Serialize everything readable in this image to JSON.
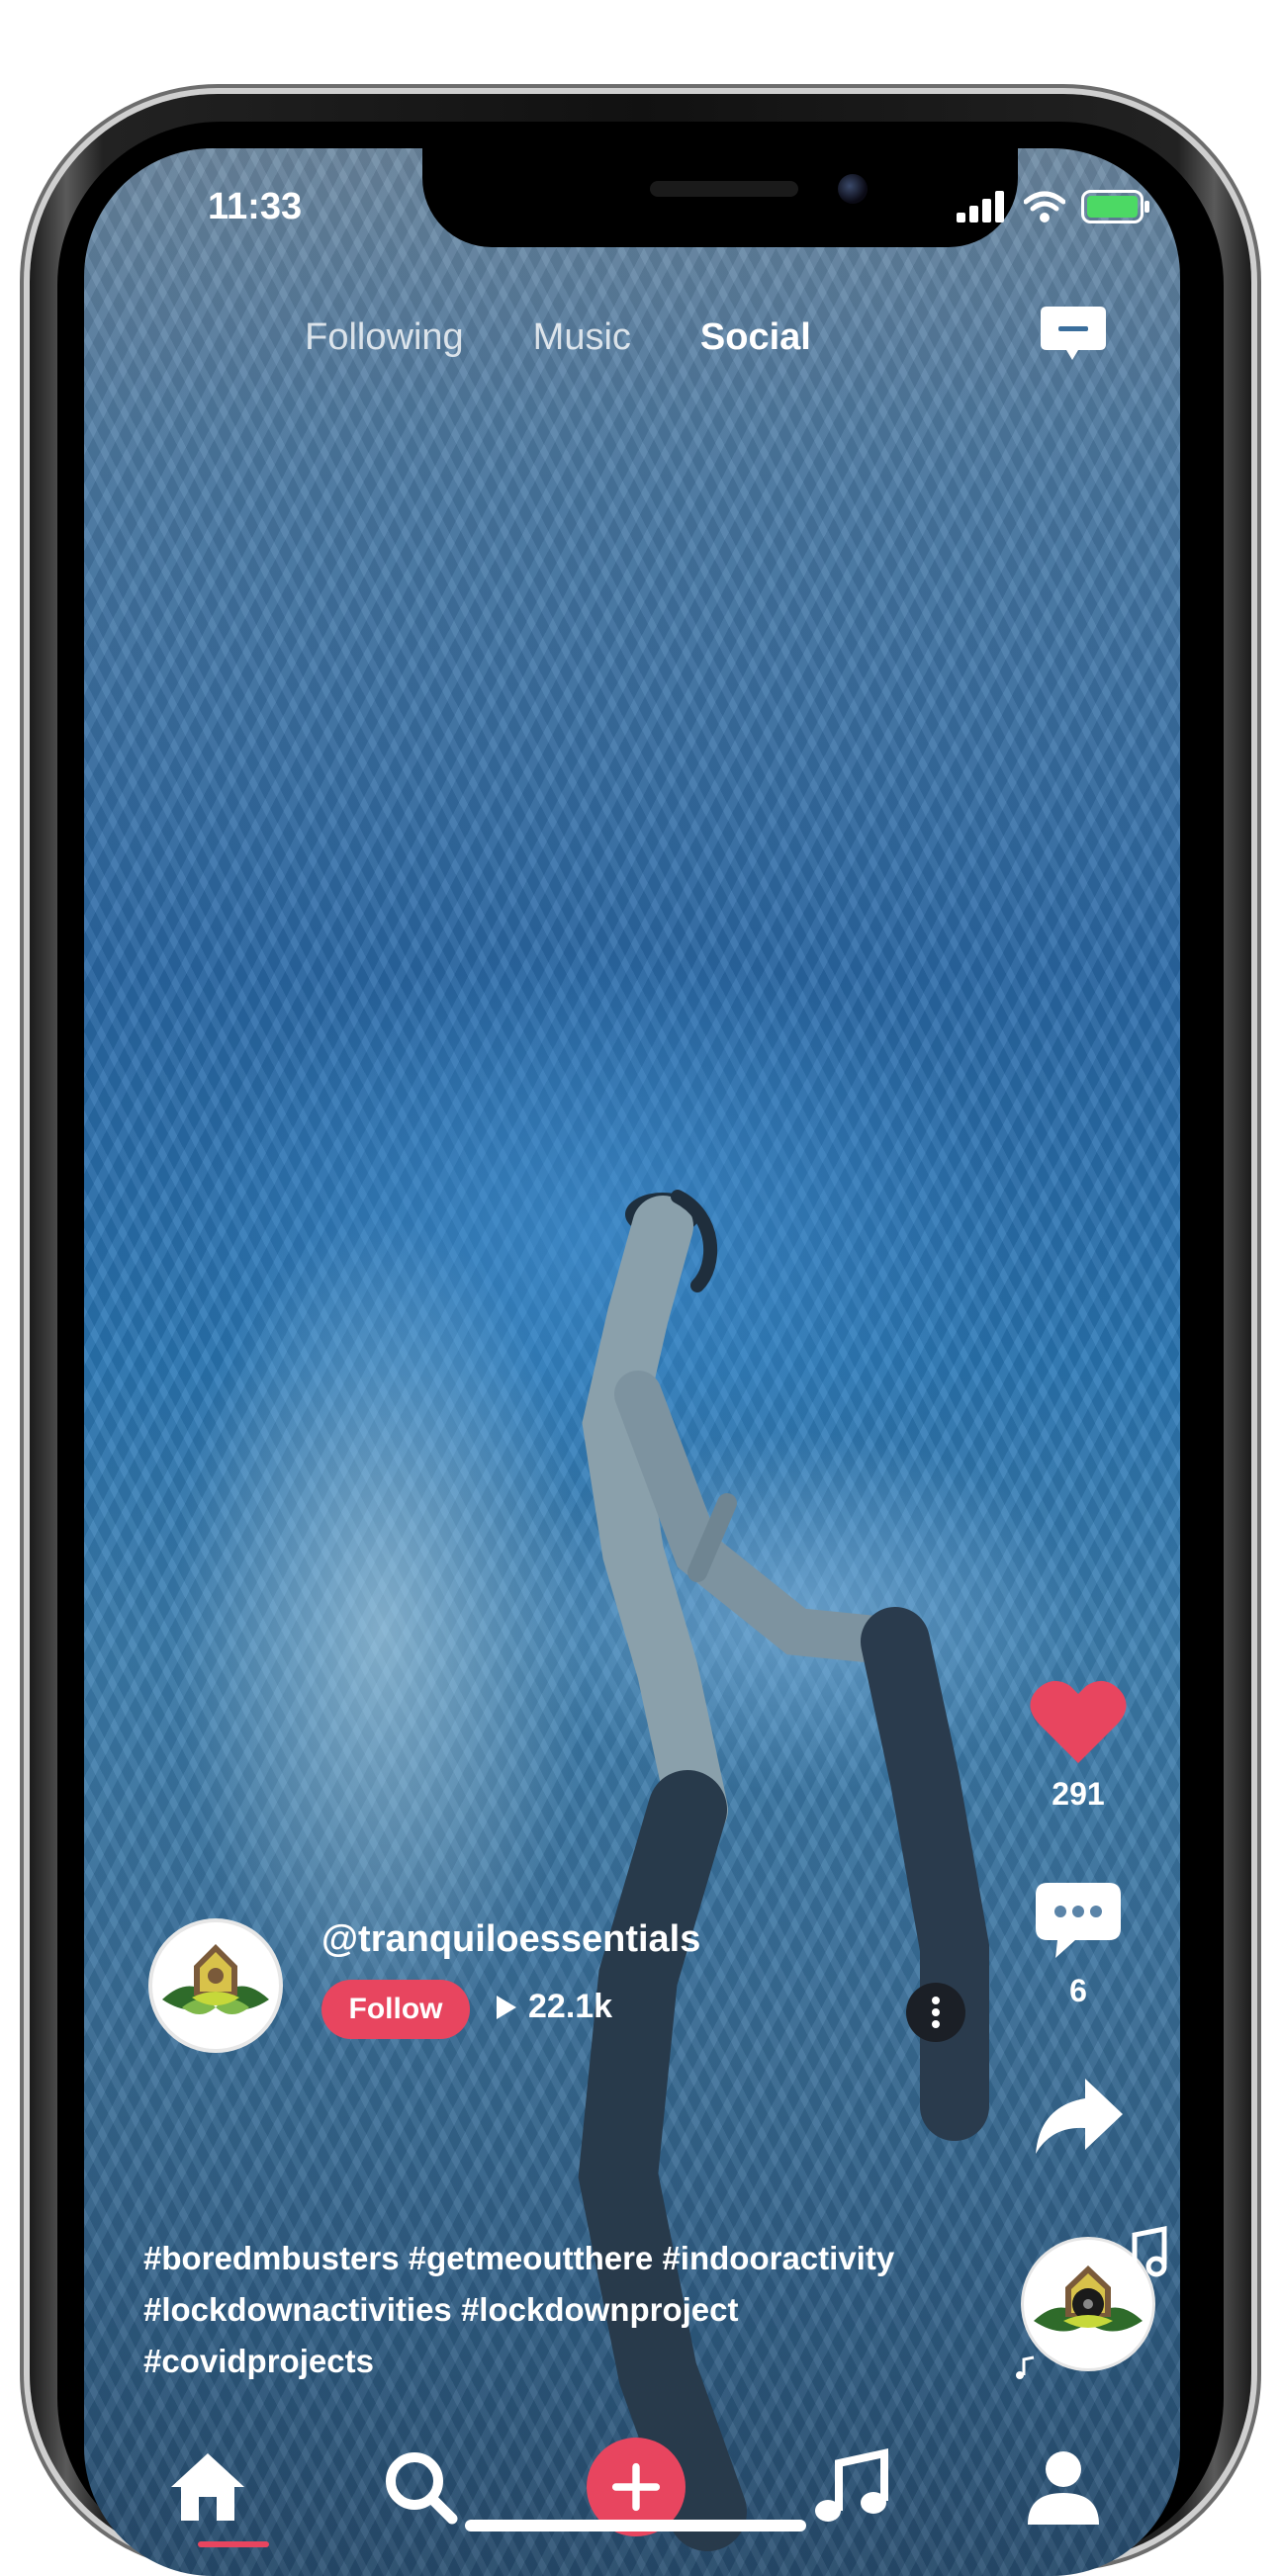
{
  "status_bar": {
    "time": "11:33"
  },
  "top_tabs": [
    {
      "label": "Following",
      "active": false
    },
    {
      "label": "Music",
      "active": false
    },
    {
      "label": "Social",
      "active": true
    }
  ],
  "rail": {
    "like_count": "291",
    "comment_count": "6"
  },
  "post": {
    "handle": "@tranquiloessentials",
    "follow_label": "Follow",
    "play_count": "22.1k",
    "caption_lines": [
      "#boredmbusters #getmeoutthere #indooractivity",
      "#lockdownactivities #lockdownproject",
      "#covidprojects"
    ]
  },
  "bottom_nav": {
    "items": [
      "home-icon",
      "search-icon",
      "create-icon",
      "music-icon",
      "profile-icon"
    ],
    "active": "home-icon"
  },
  "colors": {
    "accent": "#e8455f",
    "like": "#e8455f",
    "text": "#ffffff",
    "battery": "#4cd964"
  }
}
